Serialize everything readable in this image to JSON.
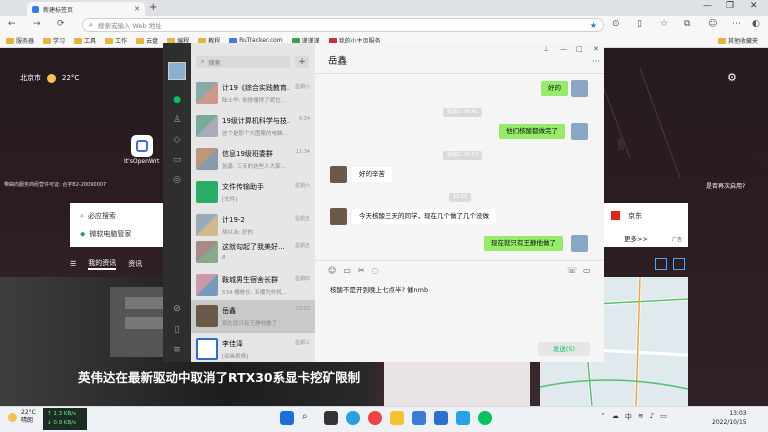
{
  "browser": {
    "tab_title": "新建标签页",
    "tab_close": "✕",
    "new_tab": "+",
    "address_placeholder": "搜索或输入 Web 地址",
    "bookmarks": [
      "服务器",
      "学习",
      "工具",
      "工作",
      "云盘",
      "编程",
      "教程",
      "RuTracker.com",
      "谨谨谨",
      "我的小主页服务"
    ],
    "other_bookmarks": "其他收藏夹"
  },
  "newtab": {
    "city": "北京市",
    "temp": "22°C",
    "app_label": "It'sOpenWrt",
    "icp": "带曲向服务商经营许可证: 合字B2-20090007",
    "left_card": [
      "必应搜索",
      "微软电脑管家"
    ],
    "news_tabs": [
      "我的资讯",
      "资讯"
    ],
    "headline": "英伟达在最新驱动中取消了RTX30系显卡挖矿限制",
    "right_card_top": "京东",
    "right_card_bottom": "更多>>",
    "right_card_ad": "广告",
    "right_text": "是否再次启用?"
  },
  "taskbar": {
    "temp": "22°C",
    "cond": "晴朗",
    "up": "↑ 1.3 KB/s",
    "down": "↓ 0.9 KB/s",
    "time": "13:03",
    "date": "2022/10/15",
    "lang": "中"
  },
  "wechat": {
    "search_placeholder": "搜索",
    "plus": "+",
    "chats": [
      {
        "name": "计19《综合实践教育...",
        "preview": "陆士华: 你很懂得了呢位...",
        "time": "星期六"
      },
      {
        "name": "19级计算机科学与技...",
        "preview": "这个是那个大图案的电脑...",
        "time": "9:34"
      },
      {
        "name": "信息19级班委群",
        "preview": "张鑫: 三天的这些人大家...",
        "time": "11:34"
      },
      {
        "name": "文件传输助手",
        "preview": "[文件]",
        "time": "星期六"
      },
      {
        "name": "计19-2",
        "preview": "胡以冰: 好的",
        "time": "星期五"
      },
      {
        "name": "这就勾起了我美好...",
        "preview": "8",
        "time": "星期五"
      },
      {
        "name": "鞍城男生宿舍长群",
        "preview": "534 楼栋长: 五楼为外机...",
        "time": "星期四"
      },
      {
        "name": "岳鑫",
        "preview": "现在就只有王静他做了",
        "time": "13:02"
      },
      {
        "name": "李佳泽",
        "preview": "[动画表情]",
        "time": "星期三"
      }
    ],
    "title": "岳鑫",
    "more": "···",
    "messages": [
      {
        "from": "me",
        "text": "好的"
      },
      {
        "ts": "星期三 16:41"
      },
      {
        "from": "me",
        "text": "他们核酸都做完了"
      },
      {
        "ts": "星期三 16:53"
      },
      {
        "from": "him",
        "text": "好的辛苦"
      },
      {
        "ts": "13:00"
      },
      {
        "from": "him",
        "text": "今天核酸三天的同学，现在几个做了几个没做"
      },
      {
        "from": "me",
        "text": "现在就只有王静他做了"
      }
    ],
    "input_text": "核酸不是开到晚上七点半? 催nmb",
    "send": "发送(S)"
  }
}
